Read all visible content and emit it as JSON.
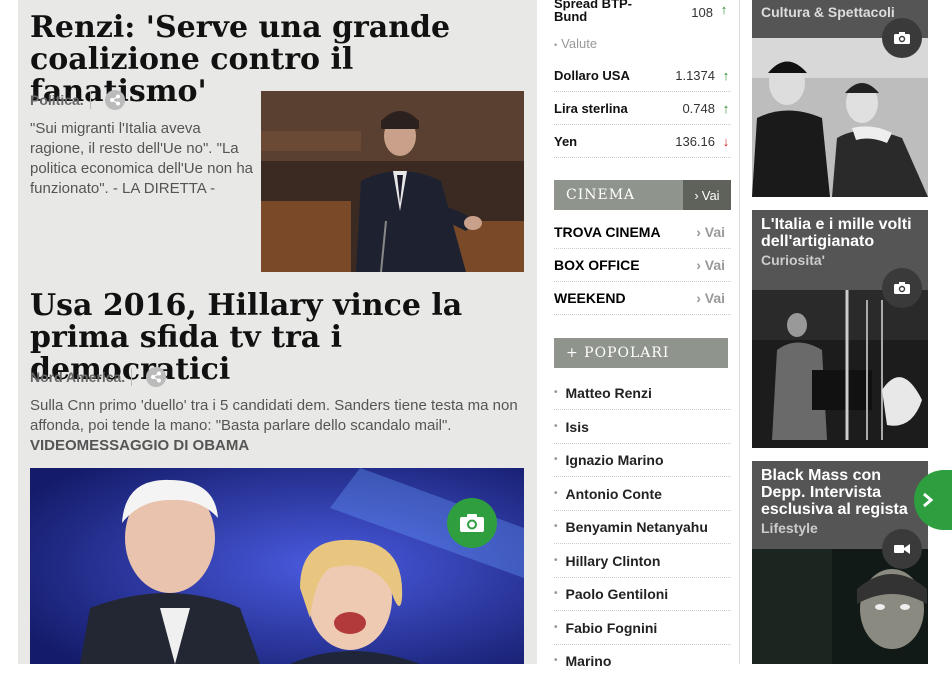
{
  "article1": {
    "title": "Renzi: 'Serve una grande coalizione contro il fanatismo'",
    "category": "Politica.",
    "summary": "\"Sui migranti l'Italia aveva ragione, il resto dell'Ue no\". \"La politica economica dell'Ue non ha funzionato\". - LA DIRETTA -"
  },
  "article2": {
    "title": "Usa 2016, Hillary vince la prima sfida tv tra i democratici",
    "category": "Nord America.",
    "summary": "Sulla Cnn primo 'duello' tra i 5 candidati dem. Sanders tiene testa ma non affonda, poi tende la mano: \"Basta parlare dello scandalo mail\".",
    "link": "VIDEOMESSAGGIO DI OBAMA"
  },
  "markets": {
    "spread": {
      "name": "Spread BTP-Bund",
      "value": "108",
      "trend": "up"
    },
    "valute_label": "Valute",
    "rows": [
      {
        "name": "Dollaro USA",
        "value": "1.1374",
        "trend": "up"
      },
      {
        "name": "Lira sterlina",
        "value": "0.748",
        "trend": "up"
      },
      {
        "name": "Yen",
        "value": "136.16",
        "trend": "down"
      }
    ]
  },
  "cinema": {
    "title": "CINEMA",
    "vai": "Vai",
    "rows": [
      {
        "label": "TROVA CINEMA",
        "vai": "Vai"
      },
      {
        "label": "BOX OFFICE",
        "vai": "Vai"
      },
      {
        "label": "WEEKEND",
        "vai": "Vai"
      }
    ]
  },
  "popolari": {
    "title": "+ POPOLARI",
    "items": [
      "Matteo Renzi",
      "Isis",
      "Ignazio Marino",
      "Antonio Conte",
      "Benyamin Netanyahu",
      "Hillary Clinton",
      "Paolo Gentiloni",
      "Fabio Fognini",
      "Marino"
    ]
  },
  "sidebar": {
    "card1": {
      "category": "Cultura & Spettacoli"
    },
    "card2": {
      "title": "L'Italia e i mille volti dell'artigianato",
      "category": "Curiosita'"
    },
    "card3": {
      "title": "Black Mass con Depp. Intervista esclusiva al regista",
      "category": "Lifestyle"
    }
  },
  "colors": {
    "accent_green": "#2e9e3e",
    "bar_gray": "#8f948c",
    "up": "#2a8a2a",
    "down": "#cc2222"
  },
  "icons": {
    "camera": "camera-icon",
    "video": "video-icon",
    "share": "share-icon",
    "next": "chevron-right-icon"
  }
}
